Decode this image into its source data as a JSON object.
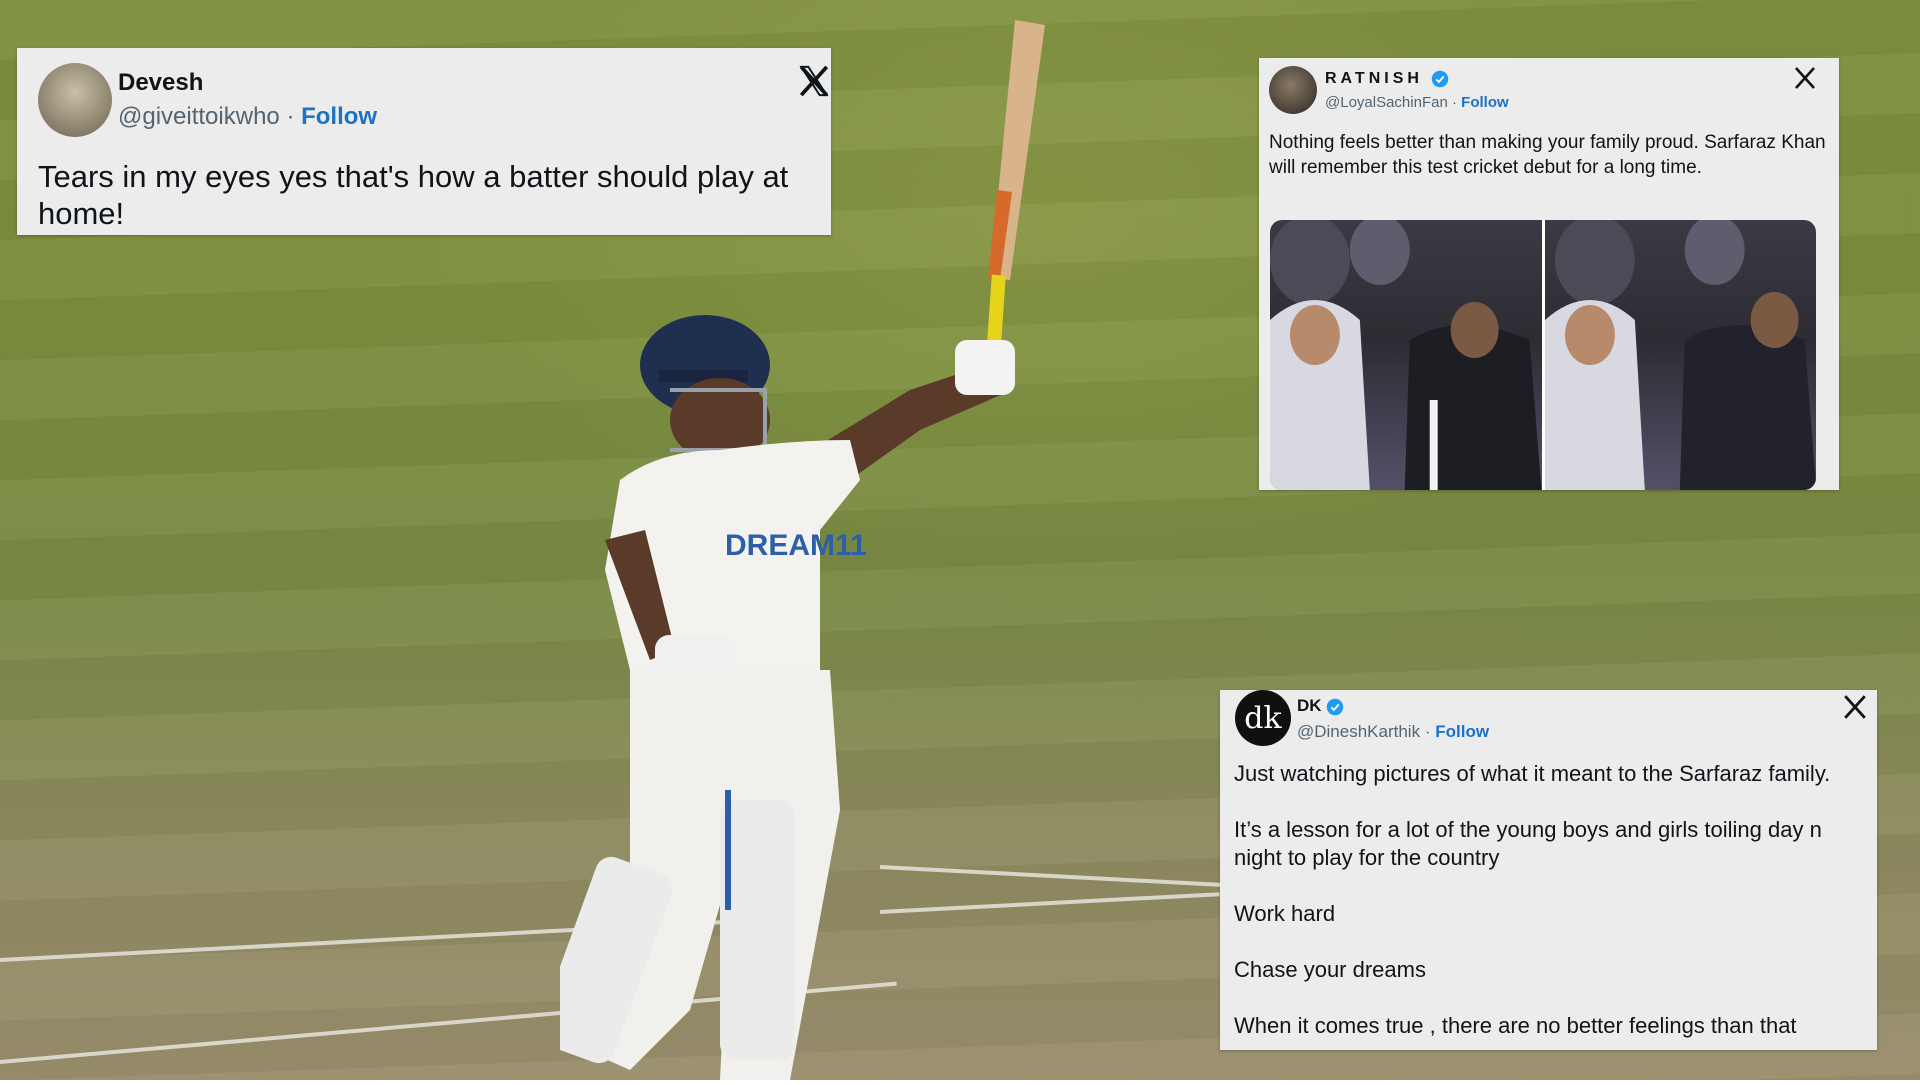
{
  "tweets": [
    {
      "name": "Devesh",
      "handle": "@giveittoikwho",
      "separator": "·",
      "follow_label": "Follow",
      "text": "Tears in my eyes yes that's how a batter should play at home!",
      "logo_icon": "x-logo-icon"
    },
    {
      "name": "RATNISH",
      "verified": true,
      "handle": "@LoyalSachinFan",
      "separator": "·",
      "follow_label": "Follow",
      "text": "Nothing feels better than making your family proud. Sarfaraz Khan will remember this test cricket debut for a long time.",
      "logo_icon": "x-logo-icon",
      "photos": 2
    },
    {
      "name": "DK",
      "verified": true,
      "avatar_text": "dk",
      "handle": "@DineshKarthik",
      "separator": "·",
      "follow_label": "Follow",
      "paragraphs": [
        "Just watching pictures of what it meant to the Sarfaraz family.",
        "It’s a lesson for a lot of the young boys and girls toiling day n night to play for the country",
        "Work hard",
        "Chase your dreams",
        "When it comes true , there are no better feelings than that"
      ],
      "logo_icon": "x-logo-icon"
    }
  ],
  "jersey_text": "DREAM11",
  "colors": {
    "card_bg": "#ececec",
    "follow_blue": "#1d72c4",
    "verified_blue": "#1d9bf0",
    "field_green": "#7a8d3e"
  }
}
